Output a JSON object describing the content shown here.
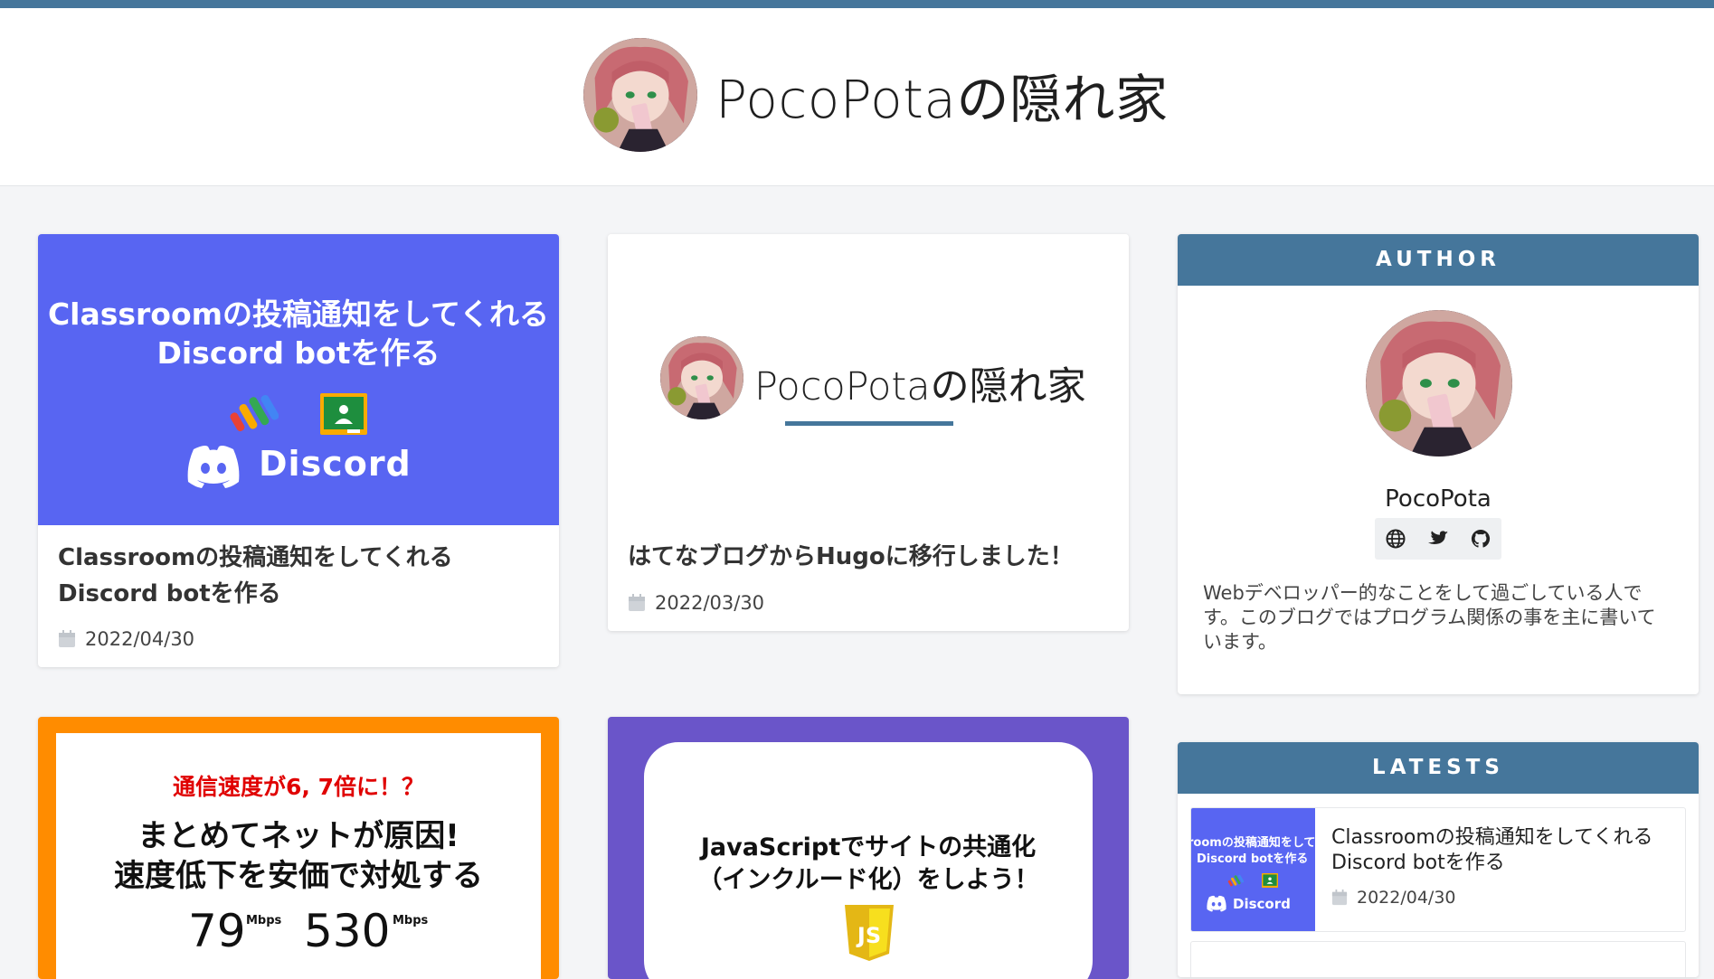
{
  "site": {
    "title": "PocoPotaの隠れ家"
  },
  "posts": [
    {
      "title": "Classroomの投稿通知をしてくれるDiscord botを作る",
      "date": "2022/04/30",
      "thumb": {
        "line1": "Classroomの投稿通知をしてくれる",
        "line2": "Discord botを作る",
        "logo": "Discord",
        "bg": "#5865f2"
      }
    },
    {
      "title": "はてなブログからHugoに移行しました！",
      "date": "2022/03/30",
      "thumb": {
        "text": "PocoPotaの隠れ家"
      }
    },
    {
      "thumb": {
        "line1": "通信速度が6, 7倍に！？",
        "line2": "まとめてネットが原因!",
        "line3": "速度低下を安価で対処する",
        "speed1": "79",
        "speed2": "530",
        "unit": "Mbps",
        "border": "#ff8c00"
      }
    },
    {
      "thumb": {
        "line1": "JavaScriptでサイトの共通化",
        "line2": "（インクルード化）をしよう！",
        "logo": "JS",
        "bg": "#6a55c9"
      }
    }
  ],
  "author": {
    "heading": "AUTHOR",
    "name": "PocoPota",
    "bio": "Webデベロッパー的なことをして過ごしている人です。このブログではプログラム関係の事を主に書いています。",
    "links": [
      "globe-icon",
      "twitter-icon",
      "github-icon"
    ]
  },
  "latests": {
    "heading": "LATESTS",
    "items": [
      {
        "title": "Classroomの投稿通知をしてくれるDiscord botを作る",
        "date": "2022/04/30",
        "thumb_line1": "roomの投稿通知をして",
        "thumb_line2": "Discord botを作る",
        "thumb_logo": "Discord"
      }
    ]
  },
  "colors": {
    "accent": "#45769b",
    "discord": "#5865f2",
    "purple": "#6a55c9",
    "orange": "#ff8c00"
  }
}
